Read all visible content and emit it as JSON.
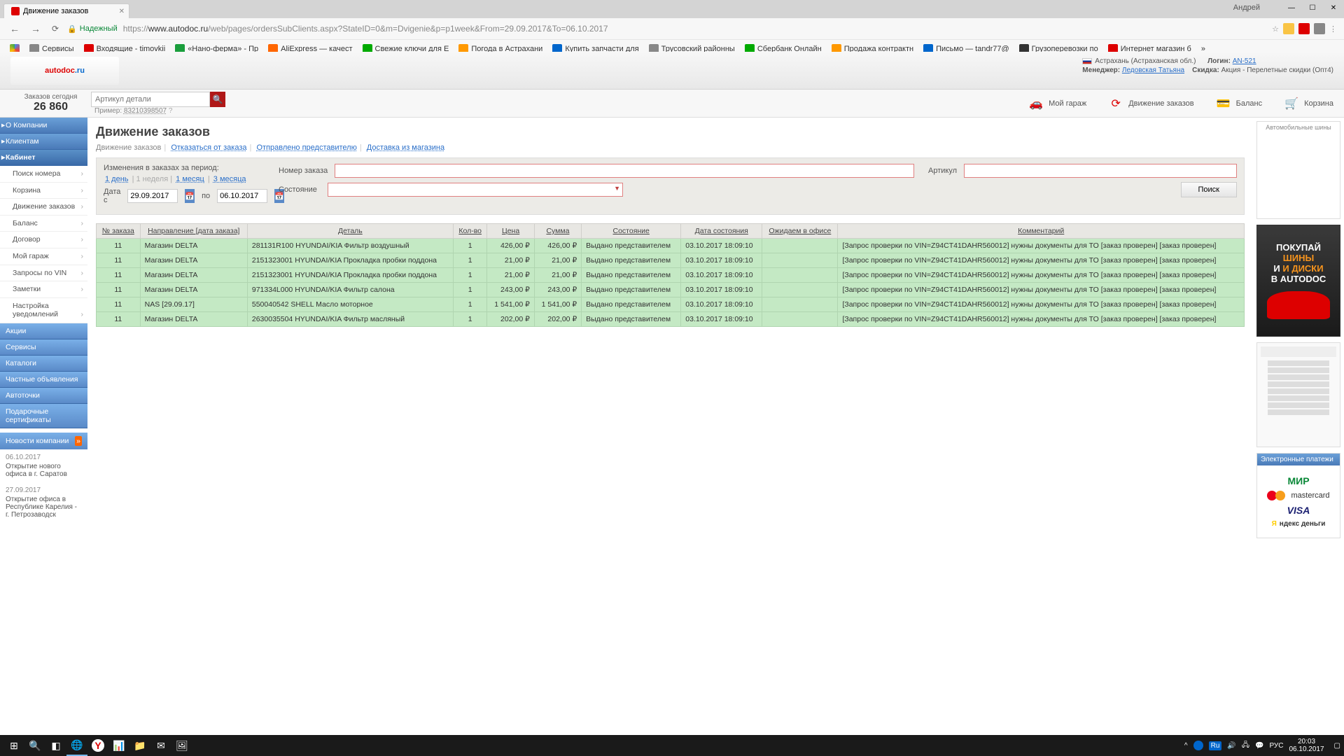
{
  "browser": {
    "tab_title": "Движение заказов",
    "user_name": "Андрей",
    "url_prefix": "Надежный",
    "url_host": "https://",
    "url_domain": "www.autodoc.ru",
    "url_path": "/web/pages/ordersSubClients.aspx?StateID=0&m=Dvigenie&p=p1week&From=29.09.2017&To=06.10.2017"
  },
  "bookmarks": [
    {
      "label": "Сервисы",
      "color": "#888"
    },
    {
      "label": "Входящие - timovkii",
      "color": "#d00"
    },
    {
      "label": "«Нано-ферма» - Пр",
      "color": "#1a9e3c"
    },
    {
      "label": "AliExpress — качест",
      "color": "#f60"
    },
    {
      "label": "Свежие ключи для E",
      "color": "#0a0"
    },
    {
      "label": "Погода в Астрахани",
      "color": "#f90"
    },
    {
      "label": "Купить запчасти для",
      "color": "#06c"
    },
    {
      "label": "Трусовский районны",
      "color": "#888"
    },
    {
      "label": "Сбербанк Онлайн",
      "color": "#0a0"
    },
    {
      "label": "Продажа контрактн",
      "color": "#f90"
    },
    {
      "label": "Письмо — tandr77@",
      "color": "#06c"
    },
    {
      "label": "Грузоперевозки по",
      "color": "#333"
    },
    {
      "label": "Интернет магазин б",
      "color": "#d00"
    }
  ],
  "header": {
    "location": "Астрахань (Астраханская обл.)",
    "login_label": "Логин:",
    "login_value": "AN-521",
    "manager_label": "Менеджер:",
    "manager_value": "Ледовская Татьяна",
    "discount_label": "Скидка:",
    "discount_value": "Акция - Перелетные скидки (Опт4)"
  },
  "searchrow": {
    "orders_today_label": "Заказов сегодня",
    "orders_today_value": "26 860",
    "placeholder": "Артикул детали",
    "example_label": "Пример:",
    "example_value": "83210398507",
    "menu": [
      {
        "label": "Мой гараж"
      },
      {
        "label": "Движение заказов"
      },
      {
        "label": "Баланс"
      },
      {
        "label": "Корзина"
      }
    ]
  },
  "sidebar": {
    "sec_company": "О Компании",
    "sec_clients": "Клиентам",
    "sec_cabinet": "Кабинет",
    "items": [
      "Поиск номера",
      "Корзина",
      "Движение заказов",
      "Баланс",
      "Договор",
      "Мой гараж",
      "Запросы по VIN",
      "Заметки",
      "Настройка уведомлений"
    ],
    "sec_actions": "Акции",
    "sec_services": "Сервисы",
    "sec_catalogs": "Каталоги",
    "sec_ads": "Частные объявления",
    "sec_points": "Автоточки",
    "sec_gift": "Подарочные сертификаты",
    "news_head": "Новости компании",
    "news": [
      {
        "date": "06.10.2017",
        "text": "Открытие нового офиса в г. Саратов"
      },
      {
        "date": "27.09.2017",
        "text": "Открытие офиса в Республике Карелия - г. Петрозаводск"
      }
    ]
  },
  "page": {
    "title": "Движение заказов",
    "tabs": {
      "t1": "Движение заказов",
      "t2": "Отказаться от заказа",
      "t3": "Отправлено представителю",
      "t4": "Доставка из магазина"
    }
  },
  "filters": {
    "period_label": "Изменения в заказах за период:",
    "q1": "1 день",
    "q2": "1 неделя",
    "q3": "1 месяц",
    "q4": "3 месяца",
    "date_from_label": "Дата с",
    "date_from": "29.09.2017",
    "date_to_label": "по",
    "date_to": "06.10.2017",
    "order_num_label": "Номер заказа",
    "article_label": "Артикул",
    "state_label": "Состояние",
    "search_btn": "Поиск"
  },
  "table": {
    "headers": [
      "№ заказа",
      "Направление [дата заказа]",
      "Деталь",
      "Кол-во",
      "Цена",
      "Сумма",
      "Состояние",
      "Дата состояния",
      "Ожидаем в офисе",
      "Комментарий"
    ],
    "rows": [
      {
        "n": "11",
        "dir": "Магазин DELTA",
        "detail": "281131R100 HYUNDAI/KIA Фильтр воздушный",
        "qty": "1",
        "price": "426,00 ₽",
        "sum": "426,00 ₽",
        "state": "Выдано представителем",
        "date": "03.10.2017 18:09:10",
        "expect": "",
        "comment": "[Запрос проверки по VIN=Z94CT41DAHR560012] нужны документы для ТО [заказ проверен] [заказ проверен]"
      },
      {
        "n": "11",
        "dir": "Магазин DELTA",
        "detail": "2151323001 HYUNDAI/KIA Прокладка пробки поддона",
        "qty": "1",
        "price": "21,00 ₽",
        "sum": "21,00 ₽",
        "state": "Выдано представителем",
        "date": "03.10.2017 18:09:10",
        "expect": "",
        "comment": "[Запрос проверки по VIN=Z94CT41DAHR560012] нужны документы для ТО [заказ проверен] [заказ проверен]"
      },
      {
        "n": "11",
        "dir": "Магазин DELTA",
        "detail": "2151323001 HYUNDAI/KIA Прокладка пробки поддона",
        "qty": "1",
        "price": "21,00 ₽",
        "sum": "21,00 ₽",
        "state": "Выдано представителем",
        "date": "03.10.2017 18:09:10",
        "expect": "",
        "comment": "[Запрос проверки по VIN=Z94CT41DAHR560012] нужны документы для ТО [заказ проверен] [заказ проверен]"
      },
      {
        "n": "11",
        "dir": "Магазин DELTA",
        "detail": "971334L000 HYUNDAI/KIA Фильтр салона",
        "qty": "1",
        "price": "243,00 ₽",
        "sum": "243,00 ₽",
        "state": "Выдано представителем",
        "date": "03.10.2017 18:09:10",
        "expect": "",
        "comment": "[Запрос проверки по VIN=Z94CT41DAHR560012] нужны документы для ТО [заказ проверен] [заказ проверен]"
      },
      {
        "n": "11",
        "dir": "NAS [29.09.17]",
        "detail": "550040542 SHELL Масло моторное",
        "qty": "1",
        "price": "1 541,00 ₽",
        "sum": "1 541,00 ₽",
        "state": "Выдано представителем",
        "date": "03.10.2017 18:09:10",
        "expect": "",
        "comment": "[Запрос проверки по VIN=Z94CT41DAHR560012] нужны документы для ТО [заказ проверен] [заказ проверен]"
      },
      {
        "n": "11",
        "dir": "Магазин DELTA",
        "detail": "2630035504 HYUNDAI/KIA Фильтр масляный",
        "qty": "1",
        "price": "202,00 ₽",
        "sum": "202,00 ₽",
        "state": "Выдано представителем",
        "date": "03.10.2017 18:09:10",
        "expect": "",
        "comment": "[Запрос проверки по VIN=Z94CT41DAHR560012] нужны документы для ТО [заказ проверен] [заказ проверен]"
      }
    ]
  },
  "rightbar": {
    "ad1_title": "Автомобильные шины",
    "tires_l1": "ПОКУПАЙ",
    "tires_l2": "ШИНЫ",
    "tires_l3": "И ДИСКИ",
    "tires_l4": "В AUTODOC",
    "pay_head": "Электронные платежи"
  },
  "taskbar": {
    "lang": "РУС",
    "time": "20:03",
    "date": "06.10.2017"
  }
}
